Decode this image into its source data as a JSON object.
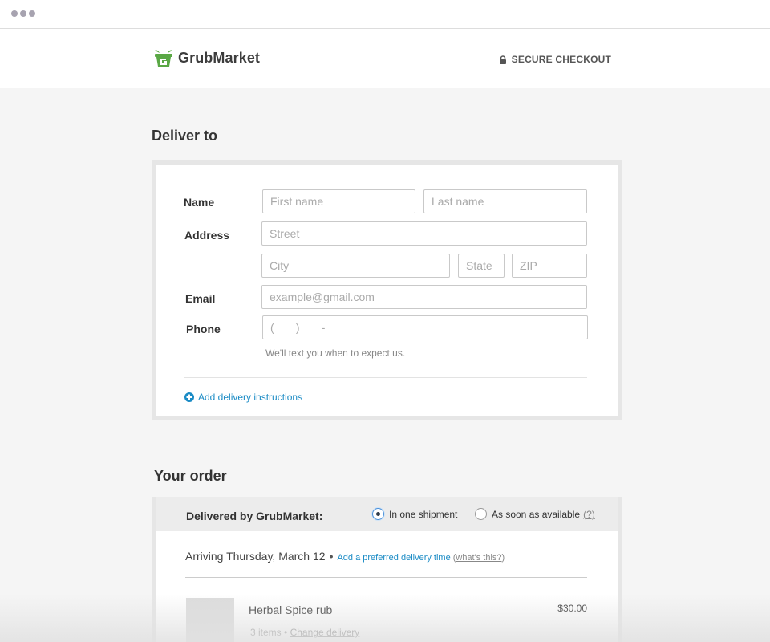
{
  "brand": {
    "name": "GrubMarket",
    "color": "#5aa845"
  },
  "header": {
    "secure_label": "SECURE CHECKOUT"
  },
  "deliver": {
    "title": "Deliver to",
    "name_label": "Name",
    "first_name_placeholder": "First name",
    "last_name_placeholder": "Last name",
    "address_label": "Address",
    "street_placeholder": "Street",
    "city_placeholder": "City",
    "state_placeholder": "State",
    "zip_placeholder": "ZIP",
    "email_label": "Email",
    "email_placeholder": "example@gmail.com",
    "phone_label": "Phone",
    "phone_placeholder": "(       )       -",
    "phone_hint": "We'll text you when to expect us.",
    "add_instructions": "Add delivery instructions"
  },
  "order": {
    "title": "Your order",
    "delivered_by": "Delivered by GrubMarket:",
    "option_one": "In one shipment",
    "option_two": "As soon as available",
    "option_two_help": "(?)",
    "selected_option": "In one shipment",
    "arriving": "Arriving Thursday, March 12",
    "separator": "•",
    "preferred_time_link": "Add a preferred delivery time",
    "whats_this": "what's this?",
    "items": [
      {
        "name": "Herbal Spice rub",
        "count": "3 items",
        "change": "Change delivery",
        "price": "$30.00"
      }
    ]
  },
  "colors": {
    "link": "#1a8bc5",
    "background": "#f5f5f5"
  }
}
